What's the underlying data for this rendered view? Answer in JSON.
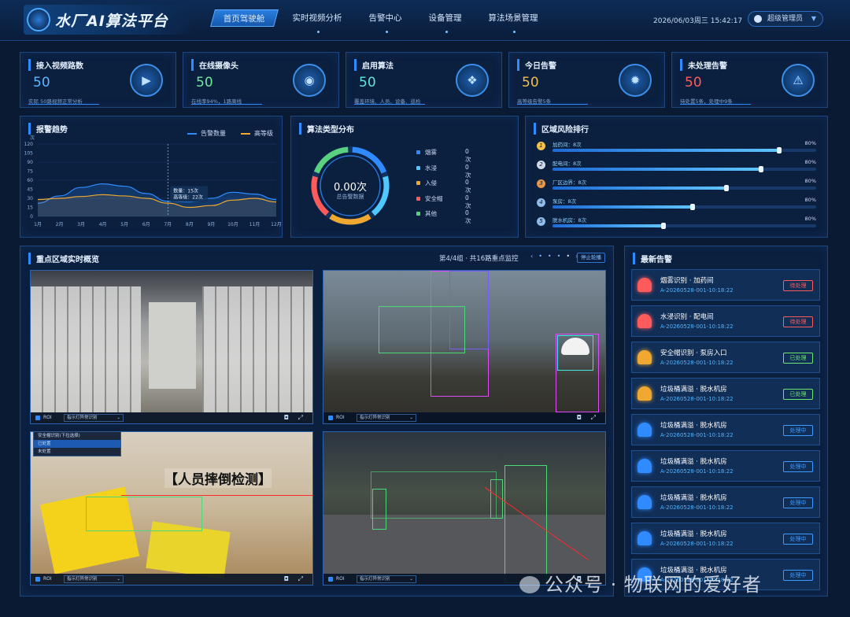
{
  "header": {
    "title": "水厂AI算法平台",
    "nav": [
      "首页驾驶舱",
      "实时视频分析",
      "告警中心",
      "设备管理",
      "算法场景管理"
    ],
    "active_nav": 0,
    "datetime": "2026/06/03周三 15:42:17",
    "user": "超级管理员"
  },
  "stats": [
    {
      "label": "接入视频路数",
      "value": "50",
      "sub": "实际 50路视频正常分析",
      "color": "#5db6ff",
      "icon": "video-icon"
    },
    {
      "label": "在线摄像头",
      "value": "50",
      "sub": "在线率94%，1路离线",
      "color": "#6ee7a0",
      "icon": "camera-icon"
    },
    {
      "label": "启用算法",
      "value": "50",
      "sub": "覆盖环境、人员、设备、巡检",
      "color": "#63e3e0",
      "icon": "cubes-icon"
    },
    {
      "label": "今日告警",
      "value": "50",
      "sub": "高等级告警5条",
      "color": "#f0c04a",
      "icon": "alarm-light-icon"
    },
    {
      "label": "未处理告警",
      "value": "50",
      "sub": "待处置5条，处理中9条",
      "color": "#ff5b5b",
      "icon": "alert-bell-icon"
    }
  ],
  "trend": {
    "title": "报警趋势",
    "legend": [
      "告警数量",
      "高等级"
    ],
    "tooltip": {
      "line1": "数量：15次",
      "line2": "高等级：22次"
    }
  },
  "chart_data": {
    "type": "area",
    "categories": [
      "1月",
      "2月",
      "3月",
      "4月",
      "5月",
      "6月",
      "7月",
      "8月",
      "9月",
      "10月",
      "11月",
      "12月"
    ],
    "ylabel": "次",
    "yticks": [
      "0",
      "15",
      "30",
      "45",
      "60",
      "75",
      "90",
      "105",
      "120"
    ],
    "ylim": [
      0,
      120
    ],
    "series": [
      {
        "name": "告警数量",
        "color": "#2f8bff",
        "values": [
          22,
          34,
          48,
          54,
          50,
          38,
          25,
          24,
          30,
          40,
          37,
          28
        ]
      },
      {
        "name": "高等级",
        "color": "#f0a830",
        "values": [
          28,
          30,
          33,
          36,
          34,
          30,
          22,
          15,
          18,
          27,
          30,
          24
        ]
      }
    ]
  },
  "algo": {
    "title": "算法类型分布",
    "total": "0.00次",
    "total_label": "总告警数据",
    "items": [
      {
        "name": "烟雾",
        "count": "0次",
        "color": "#2f8bff"
      },
      {
        "name": "水浸",
        "count": "0次",
        "color": "#4fc8ff"
      },
      {
        "name": "入侵",
        "count": "0次",
        "color": "#f0a830"
      },
      {
        "name": "安全帽",
        "count": "0次",
        "color": "#ff5b5b"
      },
      {
        "name": "其他",
        "count": "0次",
        "color": "#5ad17e"
      }
    ]
  },
  "risk": {
    "title": "区域风险排行",
    "rows": [
      {
        "rank": "1",
        "name": "加药间：8次",
        "pct": "80%",
        "level": 0.86,
        "color": "#f0c04a"
      },
      {
        "rank": "2",
        "name": "配电间：8次",
        "pct": "80%",
        "level": 0.79,
        "color": "#cfd8e6"
      },
      {
        "rank": "3",
        "name": "厂区边界：8次",
        "pct": "80%",
        "level": 0.66,
        "color": "#e8964a"
      },
      {
        "rank": "4",
        "name": "泵房：8次",
        "pct": "80%",
        "level": 0.53,
        "color": "#8fbde8"
      },
      {
        "rank": "5",
        "name": "脱水机房：8次",
        "pct": "80%",
        "level": 0.42,
        "color": "#8fbde8"
      }
    ]
  },
  "cameras": {
    "title": "重点区域实时概览",
    "pager": "第4/4组 · 共16路重点监控",
    "pager_btn": "停止轮播",
    "roi": "ROI",
    "select": "指示灯异常识别",
    "overlay_text": "【人员摔倒检测】",
    "dropdown": [
      "安全帽识别(下拉选择)",
      "已处置",
      "未处置"
    ]
  },
  "alerts": {
    "title": "最新告警",
    "items": [
      {
        "title": "烟雾识别 · 加药间",
        "id": "A-20260528-001-10:18:22",
        "status": "待处理",
        "status_color": "#ff5b5b",
        "bell": "#ff5b5b"
      },
      {
        "title": "水浸识别 · 配电间",
        "id": "A-20260528-001-10:18:22",
        "status": "待处理",
        "status_color": "#ff5b5b",
        "bell": "#ff5b5b"
      },
      {
        "title": "安全帽识别 · 泵房入口",
        "id": "A-20260528-001-10:18:22",
        "status": "已处理",
        "status_color": "#6ee76e",
        "bell": "#f0a830"
      },
      {
        "title": "垃圾桶满溢 · 脱水机房",
        "id": "A-20260528-001-10:18:22",
        "status": "已处理",
        "status_color": "#6ee76e",
        "bell": "#f0a830"
      },
      {
        "title": "垃圾桶满溢 · 脱水机房",
        "id": "A-20260528-001-10:18:22",
        "status": "处理中",
        "status_color": "#3e9bff",
        "bell": "#2f8bff"
      },
      {
        "title": "垃圾桶满溢 · 脱水机房",
        "id": "A-20260528-001-10:18:22",
        "status": "处理中",
        "status_color": "#3e9bff",
        "bell": "#2f8bff"
      },
      {
        "title": "垃圾桶满溢 · 脱水机房",
        "id": "A-20260528-001-10:18:22",
        "status": "处理中",
        "status_color": "#3e9bff",
        "bell": "#2f8bff"
      },
      {
        "title": "垃圾桶满溢 · 脱水机房",
        "id": "A-20260528-001-10:18:22",
        "status": "处理中",
        "status_color": "#3e9bff",
        "bell": "#2f8bff"
      },
      {
        "title": "垃圾桶满溢 · 脱水机房",
        "id": "A-20260528-001-10:18:22",
        "status": "处理中",
        "status_color": "#3e9bff",
        "bell": "#2f8bff"
      }
    ]
  },
  "watermark": "公众号 · 物联网的爱好者"
}
